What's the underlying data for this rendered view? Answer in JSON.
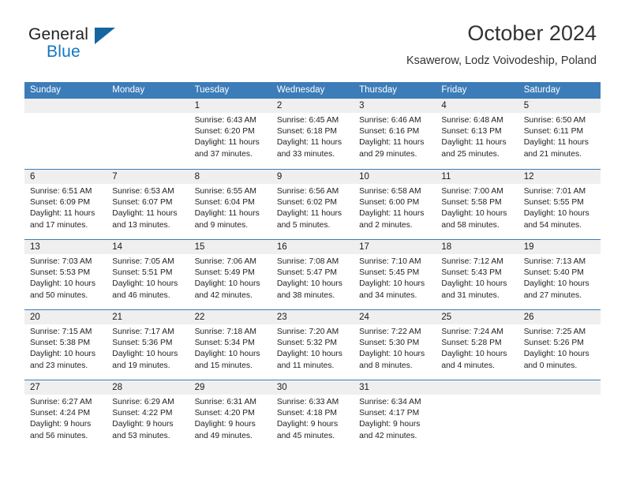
{
  "logo": {
    "primary_text": "General",
    "secondary_text": "Blue",
    "primary_color": "#222222",
    "secondary_color": "#1277c4",
    "triangle_color": "#15659f"
  },
  "header": {
    "title": "October 2024",
    "subtitle": "Ksawerow, Lodz Voivodeship, Poland"
  },
  "calendar": {
    "header_bg": "#3c7cb9",
    "daynum_bg": "#efefef",
    "weekdays": [
      "Sunday",
      "Monday",
      "Tuesday",
      "Wednesday",
      "Thursday",
      "Friday",
      "Saturday"
    ],
    "weeks": [
      [
        {
          "day": "",
          "sunrise": "",
          "sunset": "",
          "daylight": "",
          "empty": true
        },
        {
          "day": "",
          "sunrise": "",
          "sunset": "",
          "daylight": "",
          "empty": true
        },
        {
          "day": "1",
          "sunrise": "Sunrise: 6:43 AM",
          "sunset": "Sunset: 6:20 PM",
          "daylight": "Daylight: 11 hours and 37 minutes."
        },
        {
          "day": "2",
          "sunrise": "Sunrise: 6:45 AM",
          "sunset": "Sunset: 6:18 PM",
          "daylight": "Daylight: 11 hours and 33 minutes."
        },
        {
          "day": "3",
          "sunrise": "Sunrise: 6:46 AM",
          "sunset": "Sunset: 6:16 PM",
          "daylight": "Daylight: 11 hours and 29 minutes."
        },
        {
          "day": "4",
          "sunrise": "Sunrise: 6:48 AM",
          "sunset": "Sunset: 6:13 PM",
          "daylight": "Daylight: 11 hours and 25 minutes."
        },
        {
          "day": "5",
          "sunrise": "Sunrise: 6:50 AM",
          "sunset": "Sunset: 6:11 PM",
          "daylight": "Daylight: 11 hours and 21 minutes."
        }
      ],
      [
        {
          "day": "6",
          "sunrise": "Sunrise: 6:51 AM",
          "sunset": "Sunset: 6:09 PM",
          "daylight": "Daylight: 11 hours and 17 minutes."
        },
        {
          "day": "7",
          "sunrise": "Sunrise: 6:53 AM",
          "sunset": "Sunset: 6:07 PM",
          "daylight": "Daylight: 11 hours and 13 minutes."
        },
        {
          "day": "8",
          "sunrise": "Sunrise: 6:55 AM",
          "sunset": "Sunset: 6:04 PM",
          "daylight": "Daylight: 11 hours and 9 minutes."
        },
        {
          "day": "9",
          "sunrise": "Sunrise: 6:56 AM",
          "sunset": "Sunset: 6:02 PM",
          "daylight": "Daylight: 11 hours and 5 minutes."
        },
        {
          "day": "10",
          "sunrise": "Sunrise: 6:58 AM",
          "sunset": "Sunset: 6:00 PM",
          "daylight": "Daylight: 11 hours and 2 minutes."
        },
        {
          "day": "11",
          "sunrise": "Sunrise: 7:00 AM",
          "sunset": "Sunset: 5:58 PM",
          "daylight": "Daylight: 10 hours and 58 minutes."
        },
        {
          "day": "12",
          "sunrise": "Sunrise: 7:01 AM",
          "sunset": "Sunset: 5:55 PM",
          "daylight": "Daylight: 10 hours and 54 minutes."
        }
      ],
      [
        {
          "day": "13",
          "sunrise": "Sunrise: 7:03 AM",
          "sunset": "Sunset: 5:53 PM",
          "daylight": "Daylight: 10 hours and 50 minutes."
        },
        {
          "day": "14",
          "sunrise": "Sunrise: 7:05 AM",
          "sunset": "Sunset: 5:51 PM",
          "daylight": "Daylight: 10 hours and 46 minutes."
        },
        {
          "day": "15",
          "sunrise": "Sunrise: 7:06 AM",
          "sunset": "Sunset: 5:49 PM",
          "daylight": "Daylight: 10 hours and 42 minutes."
        },
        {
          "day": "16",
          "sunrise": "Sunrise: 7:08 AM",
          "sunset": "Sunset: 5:47 PM",
          "daylight": "Daylight: 10 hours and 38 minutes."
        },
        {
          "day": "17",
          "sunrise": "Sunrise: 7:10 AM",
          "sunset": "Sunset: 5:45 PM",
          "daylight": "Daylight: 10 hours and 34 minutes."
        },
        {
          "day": "18",
          "sunrise": "Sunrise: 7:12 AM",
          "sunset": "Sunset: 5:43 PM",
          "daylight": "Daylight: 10 hours and 31 minutes."
        },
        {
          "day": "19",
          "sunrise": "Sunrise: 7:13 AM",
          "sunset": "Sunset: 5:40 PM",
          "daylight": "Daylight: 10 hours and 27 minutes."
        }
      ],
      [
        {
          "day": "20",
          "sunrise": "Sunrise: 7:15 AM",
          "sunset": "Sunset: 5:38 PM",
          "daylight": "Daylight: 10 hours and 23 minutes."
        },
        {
          "day": "21",
          "sunrise": "Sunrise: 7:17 AM",
          "sunset": "Sunset: 5:36 PM",
          "daylight": "Daylight: 10 hours and 19 minutes."
        },
        {
          "day": "22",
          "sunrise": "Sunrise: 7:18 AM",
          "sunset": "Sunset: 5:34 PM",
          "daylight": "Daylight: 10 hours and 15 minutes."
        },
        {
          "day": "23",
          "sunrise": "Sunrise: 7:20 AM",
          "sunset": "Sunset: 5:32 PM",
          "daylight": "Daylight: 10 hours and 11 minutes."
        },
        {
          "day": "24",
          "sunrise": "Sunrise: 7:22 AM",
          "sunset": "Sunset: 5:30 PM",
          "daylight": "Daylight: 10 hours and 8 minutes."
        },
        {
          "day": "25",
          "sunrise": "Sunrise: 7:24 AM",
          "sunset": "Sunset: 5:28 PM",
          "daylight": "Daylight: 10 hours and 4 minutes."
        },
        {
          "day": "26",
          "sunrise": "Sunrise: 7:25 AM",
          "sunset": "Sunset: 5:26 PM",
          "daylight": "Daylight: 10 hours and 0 minutes."
        }
      ],
      [
        {
          "day": "27",
          "sunrise": "Sunrise: 6:27 AM",
          "sunset": "Sunset: 4:24 PM",
          "daylight": "Daylight: 9 hours and 56 minutes."
        },
        {
          "day": "28",
          "sunrise": "Sunrise: 6:29 AM",
          "sunset": "Sunset: 4:22 PM",
          "daylight": "Daylight: 9 hours and 53 minutes."
        },
        {
          "day": "29",
          "sunrise": "Sunrise: 6:31 AM",
          "sunset": "Sunset: 4:20 PM",
          "daylight": "Daylight: 9 hours and 49 minutes."
        },
        {
          "day": "30",
          "sunrise": "Sunrise: 6:33 AM",
          "sunset": "Sunset: 4:18 PM",
          "daylight": "Daylight: 9 hours and 45 minutes."
        },
        {
          "day": "31",
          "sunrise": "Sunrise: 6:34 AM",
          "sunset": "Sunset: 4:17 PM",
          "daylight": "Daylight: 9 hours and 42 minutes."
        },
        {
          "day": "",
          "sunrise": "",
          "sunset": "",
          "daylight": "",
          "empty": true
        },
        {
          "day": "",
          "sunrise": "",
          "sunset": "",
          "daylight": "",
          "empty": true
        }
      ]
    ]
  }
}
